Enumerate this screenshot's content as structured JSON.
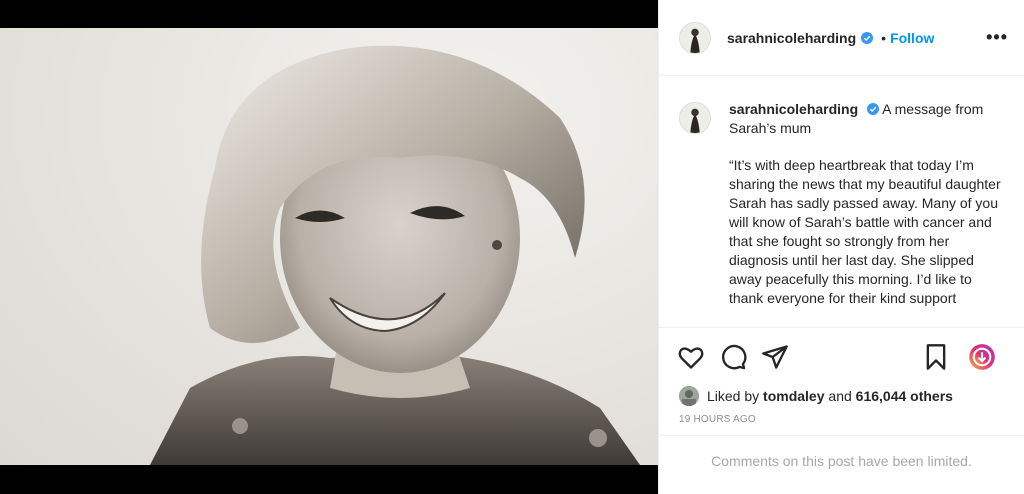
{
  "post": {
    "username": "sarahnicoleharding",
    "separator": "•",
    "follow_label": "Follow",
    "more_label": "•••",
    "caption_intro": "A message from Sarah’s mum",
    "caption_body": "“It’s with deep heartbreak that today I’m sharing the news that my beautiful daughter Sarah has sadly passed away. Many of you will know of Sarah’s battle with cancer and that she fought so strongly from her diagnosis until her last day. She slipped away peacefully this morning. I’d like to thank everyone for their kind support",
    "liked_by_prefix": "Liked by",
    "liked_by_user": "tomdaley",
    "liked_by_and": "and",
    "liked_by_others": "616,044 others",
    "timestamp": "19 HOURS AGO",
    "comments_notice": "Comments on this post have been limited."
  },
  "icons": {
    "verified": "verified-badge-icon",
    "like": "heart-icon",
    "comment": "comment-icon",
    "share": "paper-plane-icon",
    "save": "bookmark-icon",
    "reels": "instagram-ring-icon"
  },
  "colors": {
    "accent": "#0095f6",
    "text": "#262626",
    "muted": "#8e8e8e",
    "verified": "#3897f0"
  }
}
